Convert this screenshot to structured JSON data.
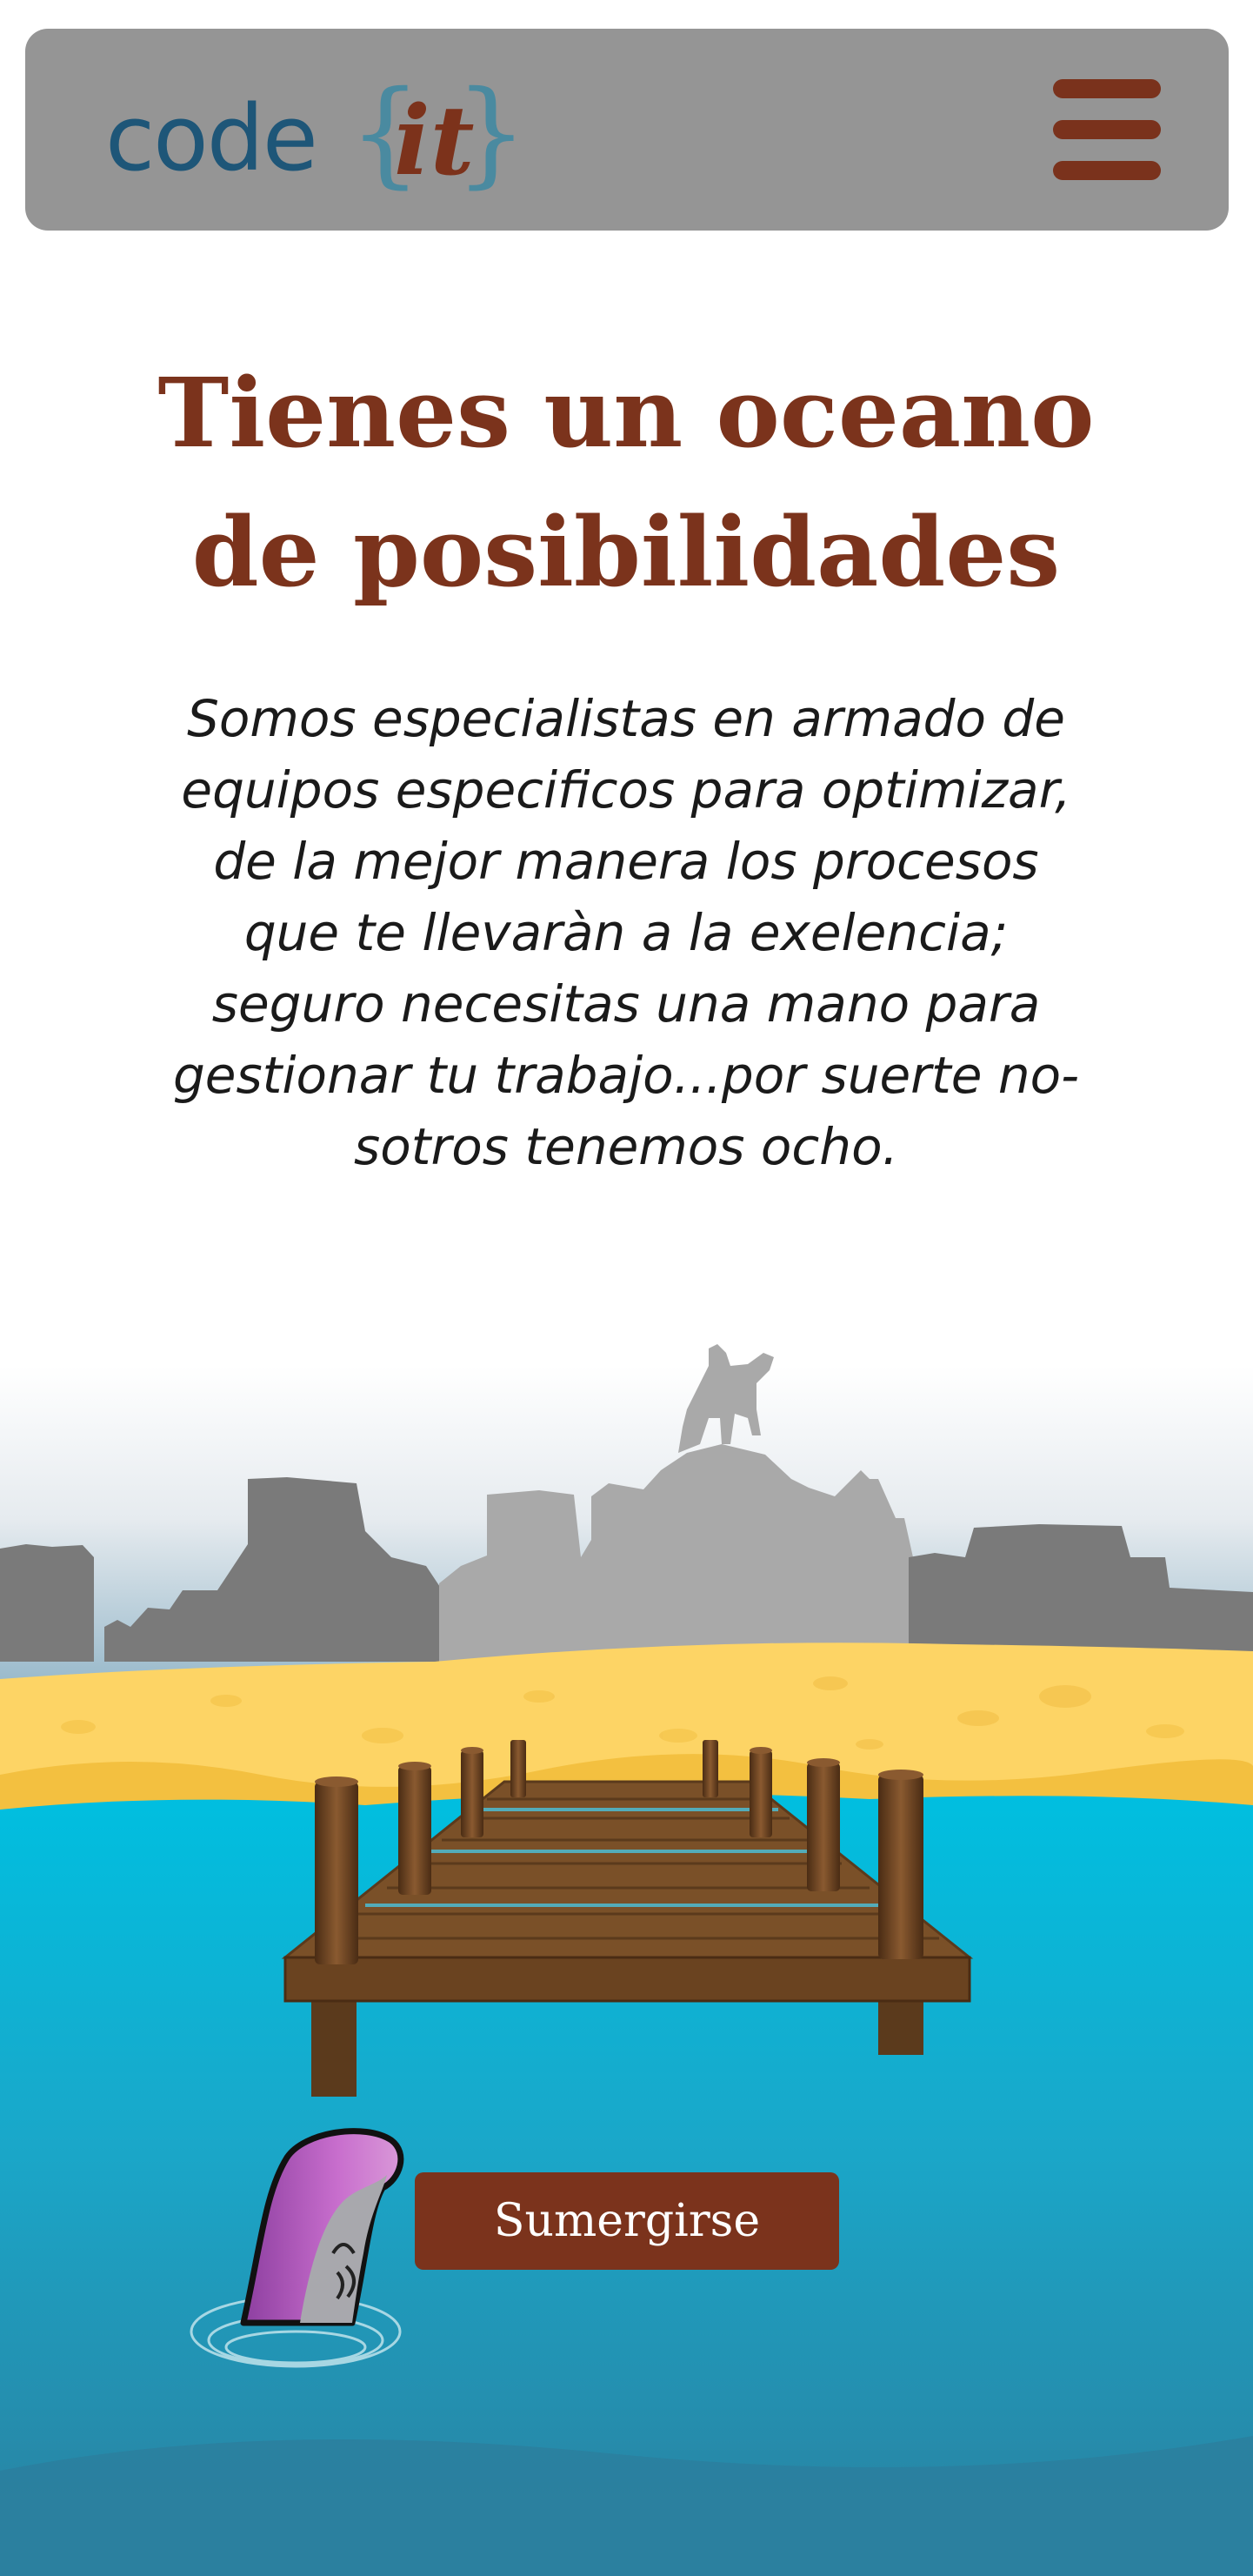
{
  "header": {
    "logo": {
      "word": "code",
      "open_brace": "{",
      "accent": "it",
      "close_brace": "}"
    },
    "menu_icon": "hamburger-menu-icon"
  },
  "hero": {
    "title_line1": "Tienes un oceano",
    "title_line2": "de posibilidades",
    "text_lines": [
      "Somos especialistas en armado de",
      "equipos especificos para optimizar,",
      "de la mejor manera los procesos",
      "que te llevaràn a la exelencia;",
      "seguro necesitas una mano para",
      "gestionar tu trabajo...por suerte no-",
      "sotros tenemos ocho."
    ]
  },
  "cta": {
    "label": "Sumergirse"
  },
  "colors": {
    "brand_brown": "#7b331c",
    "brand_blue": "#1e5678",
    "navbar_gray": "#959595",
    "ocean": "#00b8d8",
    "sand": "#fdd465"
  }
}
